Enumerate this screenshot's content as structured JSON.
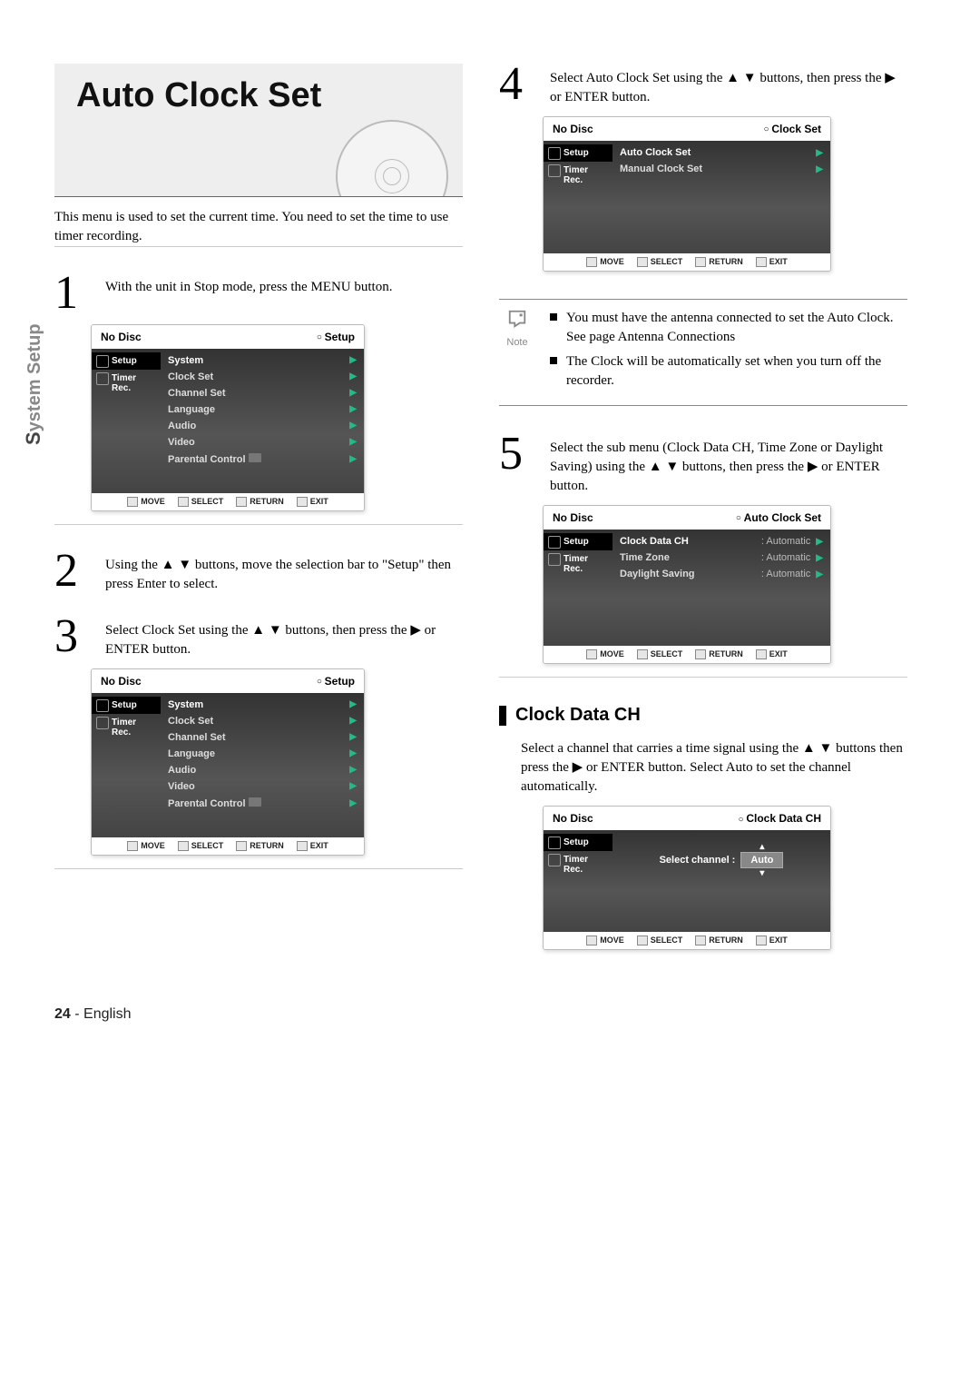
{
  "sidebar": {
    "first": "S",
    "rest": "ystem Setup"
  },
  "title": "Auto Clock Set",
  "intro": "This menu is used to set the current time. You need to set the time to use timer recording.",
  "steps": {
    "s1": {
      "num": "1",
      "text": "With the unit in Stop mode, press the MENU button."
    },
    "s2": {
      "num": "2",
      "text": "Using the ▲ ▼ buttons, move the selection bar to \"Setup\" then press Enter to select."
    },
    "s3": {
      "num": "3",
      "text": "Select Clock Set using the ▲ ▼ buttons, then press the ▶ or ENTER button."
    },
    "s4": {
      "num": "4",
      "text": "Select Auto Clock Set using the ▲ ▼ buttons, then press the ▶ or ENTER button."
    },
    "s5": {
      "num": "5",
      "text": "Select the sub menu (Clock Data CH, Time Zone or Daylight Saving) using the ▲ ▼ buttons, then press the ▶ or ENTER button."
    }
  },
  "osd_common": {
    "nodisc": "No Disc",
    "side_setup": "Setup",
    "side_timer": "Timer Rec.",
    "foot_move": "MOVE",
    "foot_select": "SELECT",
    "foot_return": "RETURN",
    "foot_exit": "EXIT"
  },
  "osd_setup": {
    "crumb": "Setup",
    "items": [
      "System",
      "Clock Set",
      "Channel Set",
      "Language",
      "Audio",
      "Video",
      "Parental Control"
    ]
  },
  "osd_clockset": {
    "crumb": "Clock Set",
    "items": [
      "Auto Clock Set",
      "Manual Clock Set"
    ]
  },
  "osd_autoclock": {
    "crumb": "Auto Clock Set",
    "rows": [
      {
        "label": "Clock Data CH",
        "value": ": Automatic"
      },
      {
        "label": "Time Zone",
        "value": ": Automatic"
      },
      {
        "label": "Daylight Saving",
        "value": ": Automatic"
      }
    ]
  },
  "osd_clockdata": {
    "crumb": "Clock Data CH",
    "line_label": "Select channel :",
    "line_value": "Auto"
  },
  "note": {
    "label": "Note",
    "items": [
      "You must have the antenna connected to set the Auto Clock. See page Antenna Connections",
      "The Clock will be automatically set when you turn off the recorder."
    ]
  },
  "section": {
    "heading": "Clock Data CH",
    "body": "Select a channel that carries a time signal using the ▲ ▼ buttons then press the ▶ or ENTER button. Select Auto to set the channel automatically."
  },
  "footer": {
    "page": "24",
    "sep": " - ",
    "lang": "English"
  }
}
